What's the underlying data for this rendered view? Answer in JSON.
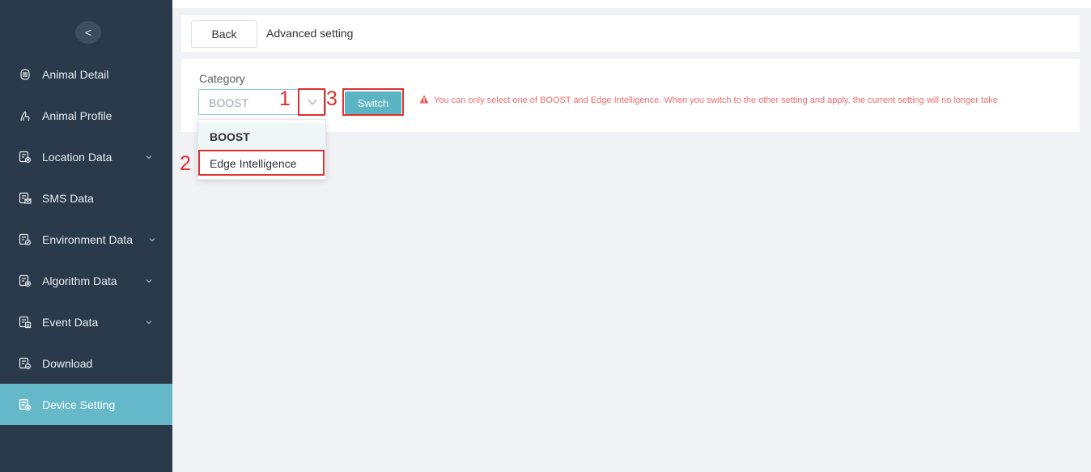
{
  "sidebar": {
    "collapse_glyph": "<",
    "items": [
      {
        "label": "Animal Detail",
        "icon": "device-icon",
        "has_chevron": false
      },
      {
        "label": "Animal Profile",
        "icon": "animal-icon",
        "has_chevron": false
      },
      {
        "label": "Location Data",
        "icon": "location-data-icon",
        "has_chevron": true
      },
      {
        "label": "SMS Data",
        "icon": "sms-data-icon",
        "has_chevron": false
      },
      {
        "label": "Environment Data",
        "icon": "environment-data-icon",
        "has_chevron": true
      },
      {
        "label": "Algorithm Data",
        "icon": "algorithm-data-icon",
        "has_chevron": true
      },
      {
        "label": "Event Data",
        "icon": "event-data-icon",
        "has_chevron": true
      },
      {
        "label": "Download",
        "icon": "download-data-icon",
        "has_chevron": false
      },
      {
        "label": "Device Setting",
        "icon": "device-setting-icon",
        "has_chevron": false,
        "active": true
      }
    ],
    "active_color": "#65b8c7"
  },
  "header": {
    "back_label": "Back",
    "title": "Advanced setting"
  },
  "form": {
    "category_label": "Category",
    "category_value": "BOOST",
    "switch_label": "Switch",
    "warning": "You can only select one of BOOST and Edge Intelligence. When you switch to the other setting and apply, the current setting will no longer take",
    "dropdown_options": [
      "BOOST",
      "Edge Intelligence"
    ]
  },
  "annotations": {
    "n1": "1",
    "n2": "2",
    "n3": "3"
  }
}
